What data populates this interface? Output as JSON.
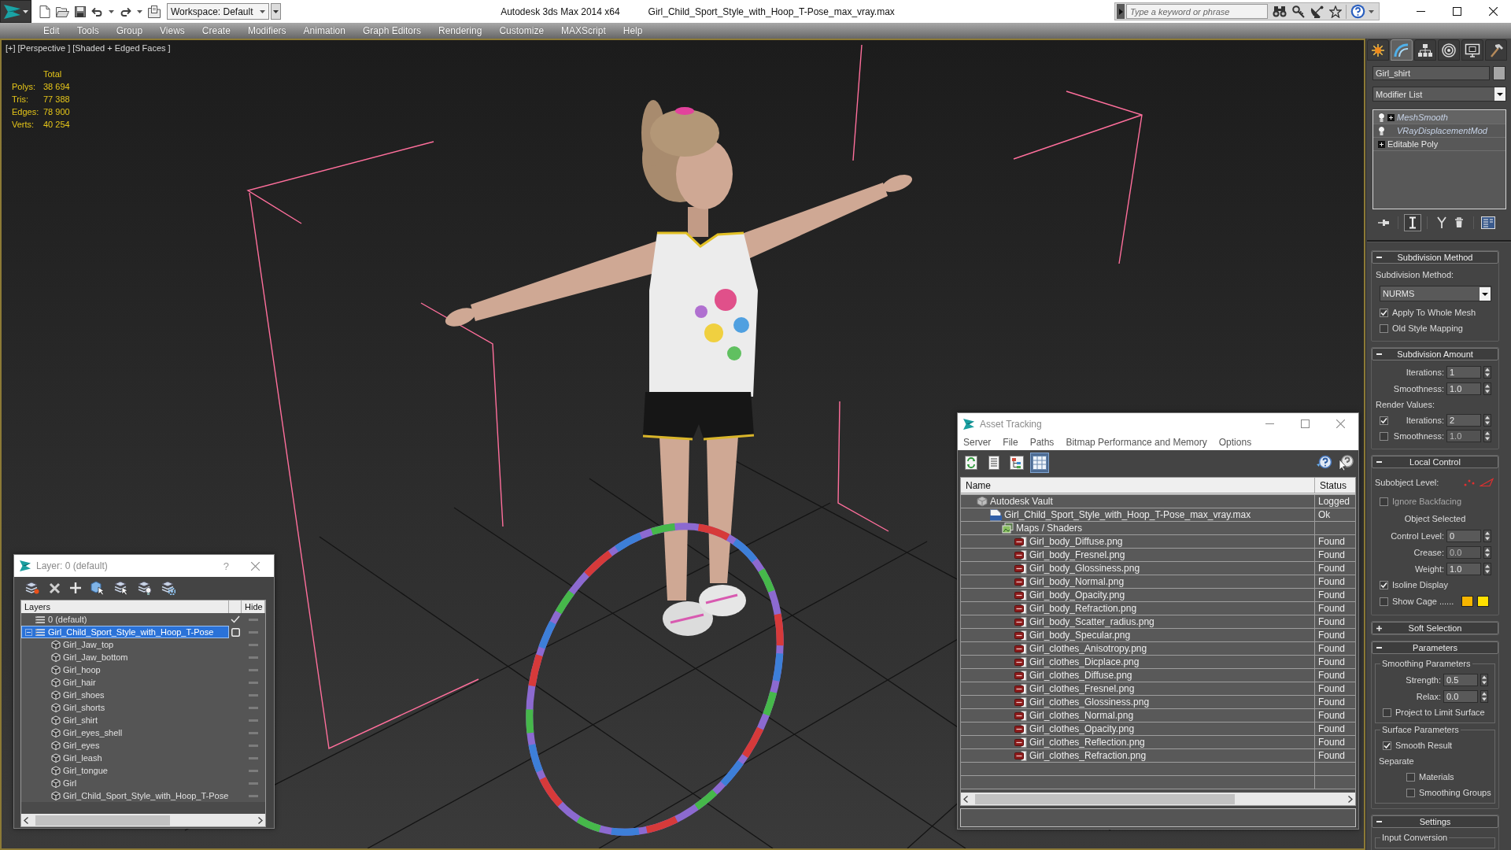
{
  "title_bar": {
    "workspace": "Workspace: Default",
    "app_name": "Autodesk 3ds Max 2014 x64",
    "file_name": "Girl_Child_Sport_Style_with_Hoop_T-Pose_max_vray.max",
    "search": {
      "placeholder": "Type a keyword or phrase"
    }
  },
  "menu": [
    "Edit",
    "Tools",
    "Group",
    "Views",
    "Create",
    "Modifiers",
    "Animation",
    "Graph Editors",
    "Rendering",
    "Customize",
    "MAXScript",
    "Help"
  ],
  "viewport": {
    "labels": [
      "[+]",
      "[Perspective ]",
      "[Shaded + Edged Faces ]"
    ],
    "stats": {
      "header": "Total",
      "rows": [
        {
          "label": "Polys:",
          "value": "38 694"
        },
        {
          "label": "Tris:",
          "value": "77 388"
        },
        {
          "label": "Edges:",
          "value": "78 900"
        },
        {
          "label": "Verts:",
          "value": "40 254"
        }
      ]
    }
  },
  "layer_dialog": {
    "title": "Layer: 0 (default)",
    "help": "?",
    "columns": [
      "Layers",
      "Hide"
    ],
    "layers": [
      {
        "name": "0 (default)",
        "kind": "layer",
        "selected": false,
        "current": true,
        "hidden": false
      },
      {
        "name": "Girl_Child_Sport_Style_with_Hoop_T-Pose",
        "kind": "layer",
        "selected": true,
        "current": false,
        "hidden": false,
        "expanded": true,
        "children": [
          {
            "name": "Girl_Jaw_top",
            "kind": "object",
            "selected": false,
            "hidden": false
          },
          {
            "name": "Girl_Jaw_bottom",
            "kind": "object",
            "selected": false,
            "hidden": false
          },
          {
            "name": "Girl_hoop",
            "kind": "object",
            "selected": false,
            "hidden": false
          },
          {
            "name": "Girl_hair",
            "kind": "object",
            "selected": false,
            "hidden": false
          },
          {
            "name": "Girl_shoes",
            "kind": "object",
            "selected": false,
            "hidden": false
          },
          {
            "name": "Girl_shorts",
            "kind": "object",
            "selected": false,
            "hidden": false
          },
          {
            "name": "Girl_shirt",
            "kind": "object",
            "selected": false,
            "hidden": false
          },
          {
            "name": "Girl_eyes_shell",
            "kind": "object",
            "selected": false,
            "hidden": false
          },
          {
            "name": "Girl_eyes",
            "kind": "object",
            "selected": false,
            "hidden": false
          },
          {
            "name": "Girl_leash",
            "kind": "object",
            "selected": false,
            "hidden": false
          },
          {
            "name": "Girl_tongue",
            "kind": "object",
            "selected": false,
            "hidden": false
          },
          {
            "name": "Girl",
            "kind": "object",
            "selected": false,
            "hidden": false
          },
          {
            "name": "Girl_Child_Sport_Style_with_Hoop_T-Pose",
            "kind": "object",
            "selected": false,
            "hidden": false
          }
        ]
      }
    ]
  },
  "asset_tracking": {
    "title": "Asset Tracking",
    "menu": [
      "Server",
      "File",
      "Paths",
      "Bitmap Performance and Memory",
      "Options"
    ],
    "toolbar": [
      {
        "kind": "refresh",
        "selected": false
      },
      {
        "kind": "list",
        "selected": false
      },
      {
        "kind": "tree",
        "selected": false
      },
      {
        "kind": "table",
        "selected": true
      }
    ],
    "columns": [
      "Name",
      "Status"
    ],
    "tree": [
      {
        "name": "Autodesk Vault",
        "status": "Logged",
        "kind": "vault",
        "children": [
          {
            "name": "Girl_Child_Sport_Style_with_Hoop_T-Pose_max_vray.max",
            "status": "Ok",
            "kind": "max",
            "children": [
              {
                "name": "Maps / Shaders",
                "kind": "folder",
                "children": [
                  {
                    "name": "Girl_body_Diffuse.png",
                    "status": "Found",
                    "kind": "png"
                  },
                  {
                    "name": "Girl_body_Fresnel.png",
                    "status": "Found",
                    "kind": "png"
                  },
                  {
                    "name": "Girl_body_Glossiness.png",
                    "status": "Found",
                    "kind": "png"
                  },
                  {
                    "name": "Girl_body_Normal.png",
                    "status": "Found",
                    "kind": "png"
                  },
                  {
                    "name": "Girl_body_Opacity.png",
                    "status": "Found",
                    "kind": "png"
                  },
                  {
                    "name": "Girl_body_Refraction.png",
                    "status": "Found",
                    "kind": "png"
                  },
                  {
                    "name": "Girl_body_Scatter_radius.png",
                    "status": "Found",
                    "kind": "png"
                  },
                  {
                    "name": "Girl_body_Specular.png",
                    "status": "Found",
                    "kind": "png"
                  },
                  {
                    "name": "Girl_clothes_Anisotropy.png",
                    "status": "Found",
                    "kind": "png"
                  },
                  {
                    "name": "Girl_clothes_Dicplace.png",
                    "status": "Found",
                    "kind": "png"
                  },
                  {
                    "name": "Girl_clothes_Diffuse.png",
                    "status": "Found",
                    "kind": "png"
                  },
                  {
                    "name": "Girl_clothes_Fresnel.png",
                    "status": "Found",
                    "kind": "png"
                  },
                  {
                    "name": "Girl_clothes_Glossiness.png",
                    "status": "Found",
                    "kind": "png"
                  },
                  {
                    "name": "Girl_clothes_Normal.png",
                    "status": "Found",
                    "kind": "png"
                  },
                  {
                    "name": "Girl_clothes_Opacity.png",
                    "status": "Found",
                    "kind": "png"
                  },
                  {
                    "name": "Girl_clothes_Reflection.png",
                    "status": "Found",
                    "kind": "png"
                  },
                  {
                    "name": "Girl_clothes_Refraction.png",
                    "status": "Found",
                    "kind": "png"
                  }
                ]
              }
            ]
          }
        ]
      }
    ]
  },
  "command_panel": {
    "tabs": [
      {
        "kind": "create",
        "selected": false
      },
      {
        "kind": "modify",
        "selected": true
      },
      {
        "kind": "hierarchy",
        "selected": false
      },
      {
        "kind": "motion",
        "selected": false
      },
      {
        "kind": "display",
        "selected": false
      },
      {
        "kind": "utilities",
        "selected": false
      }
    ],
    "object_name": "Girl_shirt",
    "modifier_list": "Modifier List",
    "stack": [
      {
        "name": "MeshSmooth",
        "kind": "modifier",
        "selected": true,
        "instanced": true,
        "enabled": true,
        "expandable": true
      },
      {
        "name": "VRayDisplacementMod",
        "kind": "modifier",
        "selected": false,
        "instanced": true,
        "enabled": true,
        "expandable": false
      },
      {
        "name": "Editable Poly",
        "kind": "base",
        "selected": false,
        "instanced": false,
        "expandable": true
      }
    ],
    "stack_buttons": [
      {
        "kind": "pin",
        "selected": false
      },
      {
        "kind": "show_result",
        "selected": true
      },
      {
        "kind": "make_unique",
        "selected": false
      },
      {
        "kind": "remove",
        "selected": false
      },
      {
        "kind": "configure",
        "selected": false
      }
    ],
    "rollouts": [
      {
        "title": "Subdivision Method",
        "expanded": true,
        "rows": [
          {
            "kind": "label",
            "text": "Subdivision Method:"
          },
          {
            "kind": "dropdown",
            "value": "NURMS"
          },
          {
            "kind": "checkbox",
            "label": "Apply To Whole Mesh",
            "checked": true,
            "disabled": false
          },
          {
            "kind": "checkbox",
            "label": "Old Style Mapping",
            "checked": false,
            "disabled": false
          }
        ]
      },
      {
        "title": "Subdivision Amount",
        "expanded": true,
        "rows": [
          {
            "kind": "spinner",
            "label": "Iterations:",
            "value": "1",
            "disabled": false
          },
          {
            "kind": "spinner",
            "label": "Smoothness:",
            "value": "1.0",
            "disabled": false
          },
          {
            "kind": "label",
            "text": "Render Values:"
          },
          {
            "kind": "check_spinner",
            "label": "Iterations:",
            "value": "2",
            "checked": true,
            "disabled": false
          },
          {
            "kind": "check_spinner",
            "label": "Smoothness:",
            "value": "1.0",
            "checked": false,
            "disabled": true
          }
        ]
      },
      {
        "title": "Local Control",
        "expanded": true,
        "rows": [
          {
            "kind": "subobject",
            "label": "Subobject Level:"
          },
          {
            "kind": "checkbox",
            "label": "Ignore Backfacing",
            "checked": false,
            "disabled": true
          },
          {
            "kind": "center_label",
            "text": "Object Selected"
          },
          {
            "kind": "spinner",
            "label": "Control Level:",
            "value": "0",
            "disabled": false
          },
          {
            "kind": "spinner",
            "label": "Crease:",
            "value": "0.0",
            "disabled": true
          },
          {
            "kind": "spinner",
            "label": "Weight:",
            "value": "1.0",
            "disabled": false
          },
          {
            "kind": "checkbox",
            "label": "Isoline Display",
            "checked": true,
            "disabled": false
          },
          {
            "kind": "cage",
            "label": "Show Cage ......",
            "checked": false,
            "swatches": [
              {
                "color": "#f7b500"
              },
              {
                "color": "#ffe000"
              }
            ]
          }
        ]
      },
      {
        "title": "Soft Selection",
        "expanded": false
      },
      {
        "title": "Parameters",
        "expanded": true,
        "rows": [
          {
            "kind": "group",
            "title": "Smoothing Parameters",
            "rows": [
              {
                "kind": "spinner",
                "label": "Strength:",
                "value": "0.5",
                "disabled": false
              },
              {
                "kind": "spinner",
                "label": "Relax:",
                "value": "0.0",
                "disabled": false
              },
              {
                "kind": "checkbox",
                "label": "Project to Limit Surface",
                "checked": false,
                "disabled": false
              }
            ]
          },
          {
            "kind": "group",
            "title": "Surface Parameters",
            "rows": [
              {
                "kind": "checkbox",
                "label": "Smooth Result",
                "checked": true,
                "disabled": false
              },
              {
                "kind": "label",
                "text": "Separate",
                "rows": [
                  {
                    "kind": "checkbox",
                    "label": "Materials",
                    "checked": false,
                    "disabled": false
                  },
                  {
                    "kind": "checkbox",
                    "label": "Smoothing Groups",
                    "checked": false,
                    "disabled": false
                  }
                ]
              }
            ]
          }
        ]
      },
      {
        "title": "Settings",
        "expanded": true,
        "rows": [
          {
            "kind": "group",
            "title": "Input Conversion"
          }
        ]
      }
    ]
  }
}
